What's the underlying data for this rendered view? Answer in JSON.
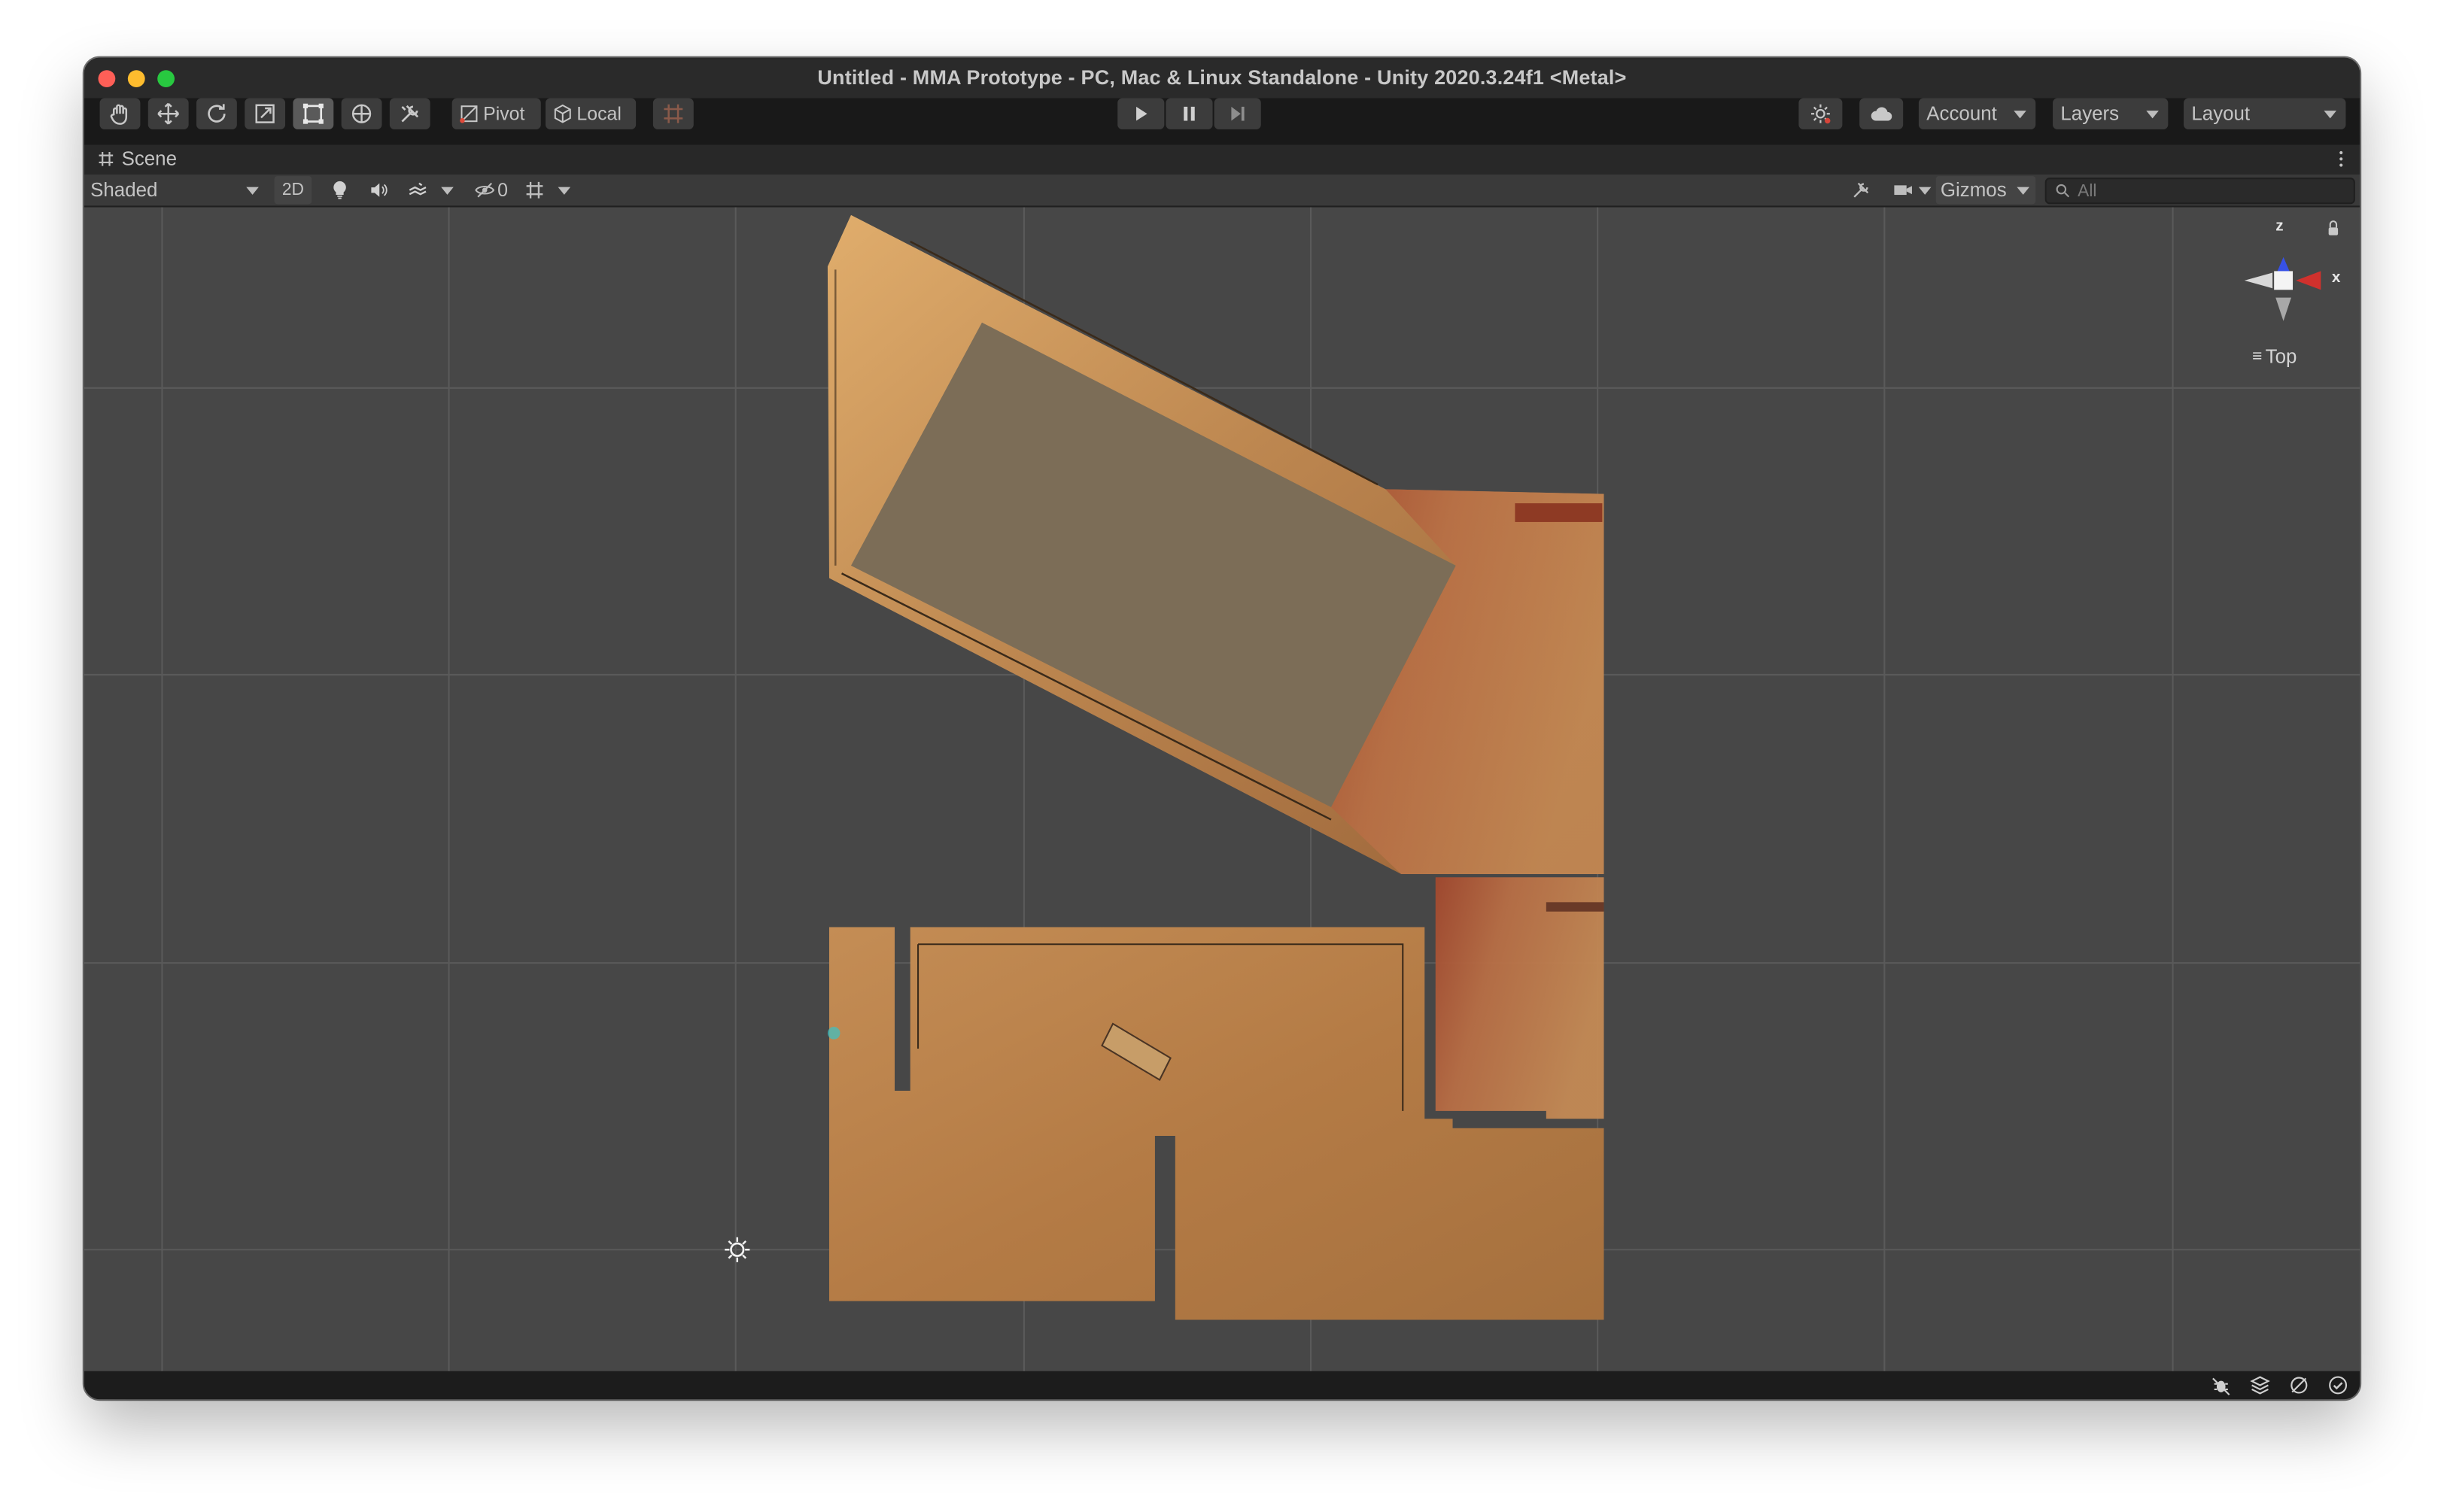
{
  "window": {
    "title": "Untitled - MMA Prototype - PC, Mac & Linux Standalone - Unity 2020.3.24f1 <Metal>"
  },
  "toolbar": {
    "tools": [
      "hand-tool-icon",
      "move-tool-icon",
      "rotate-tool-icon",
      "scale-tool-icon",
      "rect-tool-icon",
      "transform-tool-icon",
      "custom-tool-icon"
    ],
    "active_tool": "rect-tool-icon",
    "pivot_label": "Pivot",
    "local_label": "Local",
    "account_label": "Account",
    "layers_label": "Layers",
    "layout_label": "Layout"
  },
  "scene_tab": {
    "label": "Scene"
  },
  "scene_toolbar": {
    "shading_mode": "Shaded",
    "mode_2d_label": "2D",
    "hidden_count": "0",
    "gizmos_label": "Gizmos",
    "search_placeholder": "All"
  },
  "orientation_gizmo": {
    "z_label": "z",
    "x_label": "x",
    "view_label": "Top"
  },
  "colors": {
    "window_bg": "#2b2b2b",
    "toolbar_bg": "#191919",
    "viewport_bg": "#474747",
    "grid_line": "#595959",
    "floor_accent": "#b9824a",
    "axis_z": "#2f4de0",
    "axis_x": "#d0312d"
  }
}
